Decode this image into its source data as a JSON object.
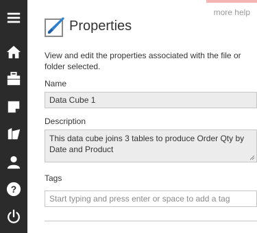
{
  "sidebar": {
    "icons": [
      {
        "name": "hamburger-menu-icon"
      },
      {
        "name": "home-icon"
      },
      {
        "name": "briefcase-icon"
      },
      {
        "name": "note-icon"
      },
      {
        "name": "folder-open-icon"
      },
      {
        "name": "user-icon"
      },
      {
        "name": "help-icon"
      },
      {
        "name": "power-icon"
      }
    ]
  },
  "header": {
    "more_help": "more help",
    "title": "Properties",
    "icon": "brush-icon"
  },
  "intro": "View and edit the properties associated with the file or folder selected.",
  "form": {
    "name_label": "Name",
    "name_value": "Data Cube 1",
    "description_label": "Description",
    "description_value": "This data cube joins 3 tables to produce Order Qty by Date and Product",
    "tags_label": "Tags",
    "tags_placeholder": "Start typing and press enter or space to add a tag"
  },
  "colors": {
    "sidebar_bg": "#2b2b2b",
    "sidebar_icon": "#ffffff",
    "accent": "#f4b6b3",
    "field_bg": "#ececec",
    "brush_blue": "#2f7fd1"
  }
}
